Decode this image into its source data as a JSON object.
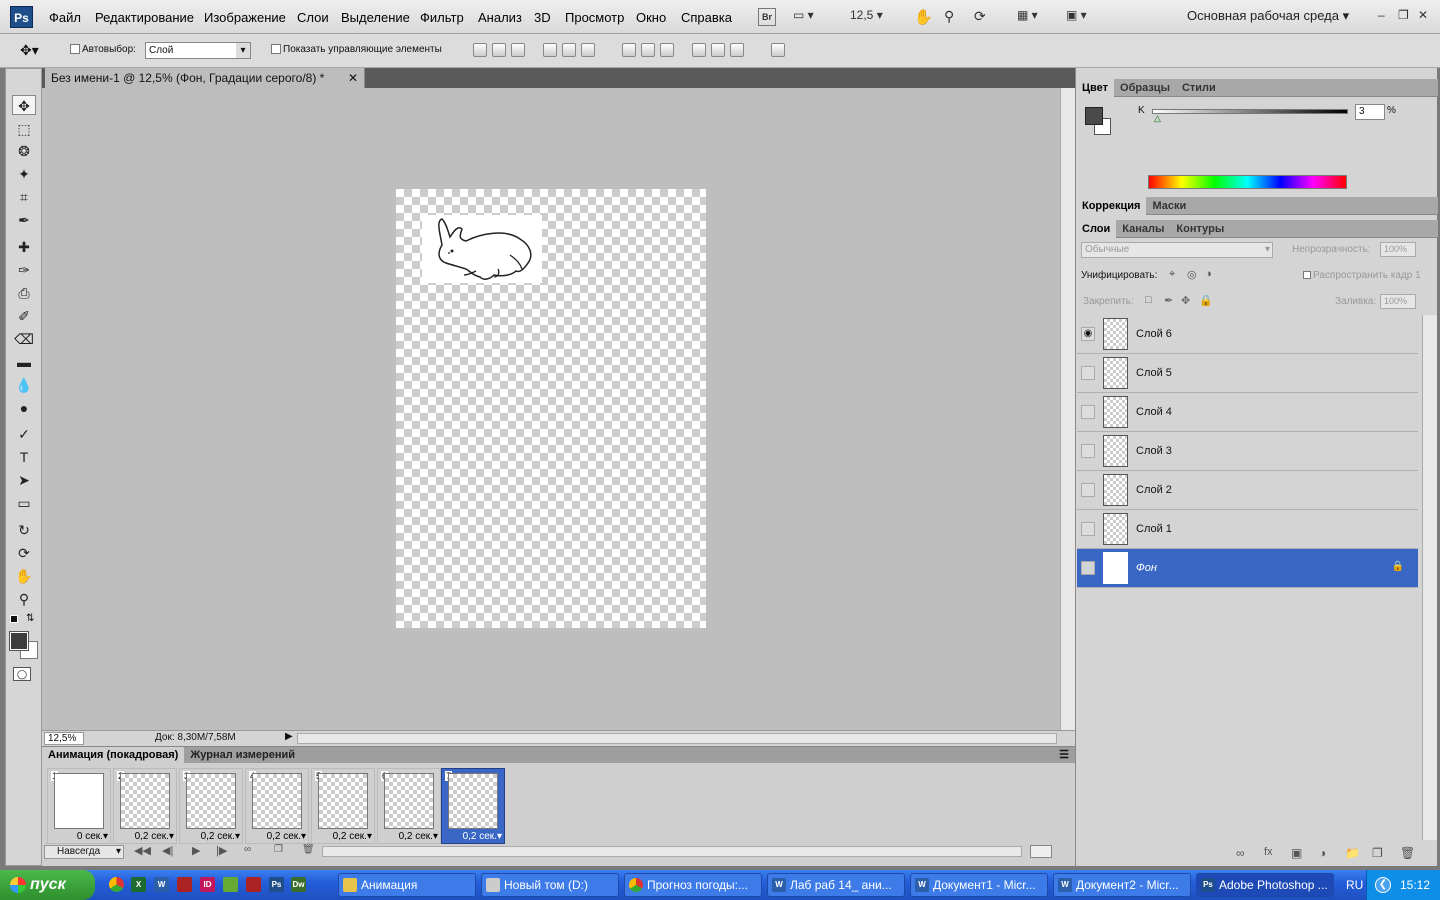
{
  "app": {
    "logo": "Ps",
    "workspace": "Основная рабочая среда",
    "zoom": "12,5"
  },
  "menu": [
    "Файл",
    "Редактирование",
    "Изображение",
    "Слои",
    "Выделение",
    "Фильтр",
    "Анализ",
    "3D",
    "Просмотр",
    "Окно",
    "Справка"
  ],
  "options": {
    "autoselect": "Автовыбор:",
    "autoselect_value": "Слой",
    "show_controls": "Показать управляющие элементы"
  },
  "document": {
    "tab_title": "Без имени-1 @ 12,5% (Фон, Градации серого/8) *",
    "zoom_field": "12,5%",
    "doc_info": "Док: 8,30M/7,58M"
  },
  "animation": {
    "tabs": [
      "Анимация (покадровая)",
      "Журнал измерений"
    ],
    "frames": [
      {
        "n": "1",
        "delay": "0 сек."
      },
      {
        "n": "2",
        "delay": "0,2 сек."
      },
      {
        "n": "3",
        "delay": "0,2 сек."
      },
      {
        "n": "4",
        "delay": "0,2 сек."
      },
      {
        "n": "5",
        "delay": "0,2 сек."
      },
      {
        "n": "6",
        "delay": "0,2 сек."
      },
      {
        "n": "7",
        "delay": "0,2 сек."
      }
    ],
    "loop": "Навсегда"
  },
  "color_panel": {
    "tabs": [
      "Цвет",
      "Образцы",
      "Стили"
    ],
    "channel": "K",
    "value": "3",
    "unit": "%"
  },
  "adjust_panel": {
    "tabs": [
      "Коррекция",
      "Маски"
    ]
  },
  "layers_panel": {
    "tabs": [
      "Слои",
      "Каналы",
      "Контуры"
    ],
    "blend_mode": "Обычные",
    "opacity_label": "Непрозрачность:",
    "opacity": "100%",
    "unify_label": "Унифицировать:",
    "propagate": "Распространить кадр 1",
    "lock_label": "Закрепить:",
    "fill_label": "Заливка:",
    "fill": "100%",
    "layers": [
      "Слой 6",
      "Слой 5",
      "Слой 4",
      "Слой 3",
      "Слой 2",
      "Слой 1",
      "Фон"
    ]
  },
  "taskbar": {
    "start": "пуск",
    "items": [
      "Анимация",
      "Новый том (D:)",
      "Прогноз погоды:...",
      "Лаб раб 14_ ани...",
      "Документ1 - Micr...",
      "Документ2 - Micr...",
      "Adobe Photoshop ..."
    ],
    "lang": "RU",
    "clock": "15:12"
  }
}
